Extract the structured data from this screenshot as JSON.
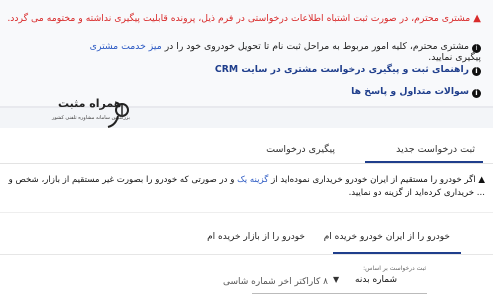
{
  "notice": {
    "warning_text": "مشتری محترم، در صورت ثبت اشتباه اطلاعات درخواستی در فرم ذیل، پرونده قابلیت پیگیری نداشته و مختومه می گردد.",
    "info_text_part1": "مشتری محترم، کلیه امور مربوط به مراحل ثبت نام تا تحویل خودروی خود را در",
    "info_link": "میز خدمت مشتری",
    "info_text_part2": "پیگیری نمایید.",
    "guide_link": "راهنمای ثبت و پیگیری درخواست مشتری در سایت CRM",
    "faq_link": "سوالات متداول و پاسخ ها"
  },
  "watermark": {
    "brand": "همراه مثبت",
    "tagline": "بزرگترین سامانه مشاوره تلفنی کشور"
  },
  "tabs": [
    {
      "label": "ثبت درخواست جدید",
      "active": true
    },
    {
      "label": "پیگیری درخواست",
      "active": false
    }
  ],
  "description": {
    "part1": "اگر خودرو را مستقیم از ایران خودرو خریداری نموده‌اید از",
    "link": "گزینه یک",
    "part2": "و در صورتی که خودرو را بصورت غیر مستقیم از بازار، شخص و ... خریداری کرده‌اید از گزینه دو",
    "part3": "نمایید."
  },
  "subtabs": [
    {
      "label": "خودرو را از ایران خودرو خریده ام",
      "active": true
    },
    {
      "label": "خودرو را از بازار خریده ام",
      "active": false
    }
  ],
  "form": {
    "select_label": "ثبت درخواست بر اساس:",
    "select_value": "شماره بدنه",
    "input_placeholder": "۸ کاراکتر اخر شماره شاسی"
  }
}
